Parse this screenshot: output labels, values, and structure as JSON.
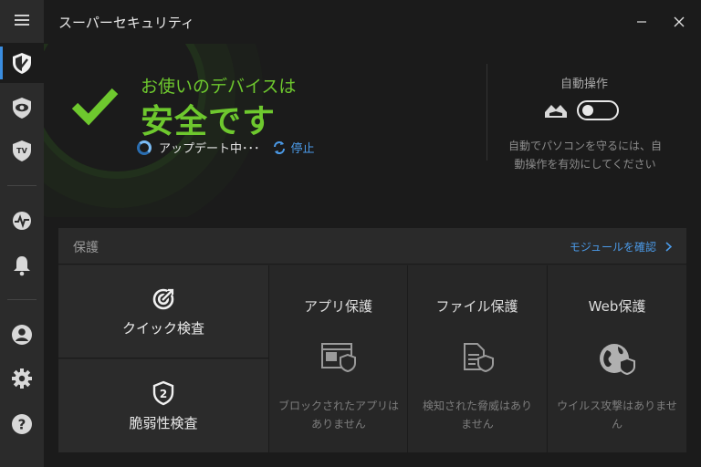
{
  "app": {
    "title": "スーパーセキュリティ"
  },
  "sidebar": {
    "items": [
      {
        "name": "menu-icon"
      },
      {
        "name": "shield-icon",
        "active": true
      },
      {
        "name": "eye-icon"
      },
      {
        "name": "tv-shield-icon"
      },
      {
        "name": "activity-icon"
      },
      {
        "name": "bell-icon"
      },
      {
        "name": "account-icon"
      },
      {
        "name": "settings-icon"
      },
      {
        "name": "help-icon"
      }
    ]
  },
  "status": {
    "subtitle": "お使いのデバイスは",
    "headline": "安全です",
    "update_text": "アップデート中･･･",
    "stop_label": "停止"
  },
  "autopilot": {
    "title": "自動操作",
    "enabled": false,
    "description": "自動でパソコンを守るには、自動操作を有効にしてください"
  },
  "protection": {
    "title": "保護",
    "link_label": "モジュールを確認",
    "actions": [
      {
        "label": "クイック検査"
      },
      {
        "label": "脆弱性検査"
      }
    ],
    "modules": [
      {
        "title": "アプリ保護",
        "description": "ブロックされたアプリはありません"
      },
      {
        "title": "ファイル保護",
        "description": "検知された脅威はありません"
      },
      {
        "title": "Web保護",
        "description": "ウイルス攻撃はありません"
      }
    ]
  },
  "colors": {
    "accent_green": "#6ec82e",
    "link_blue": "#4b9ae8",
    "sidebar_bg": "#2b2b2b"
  }
}
